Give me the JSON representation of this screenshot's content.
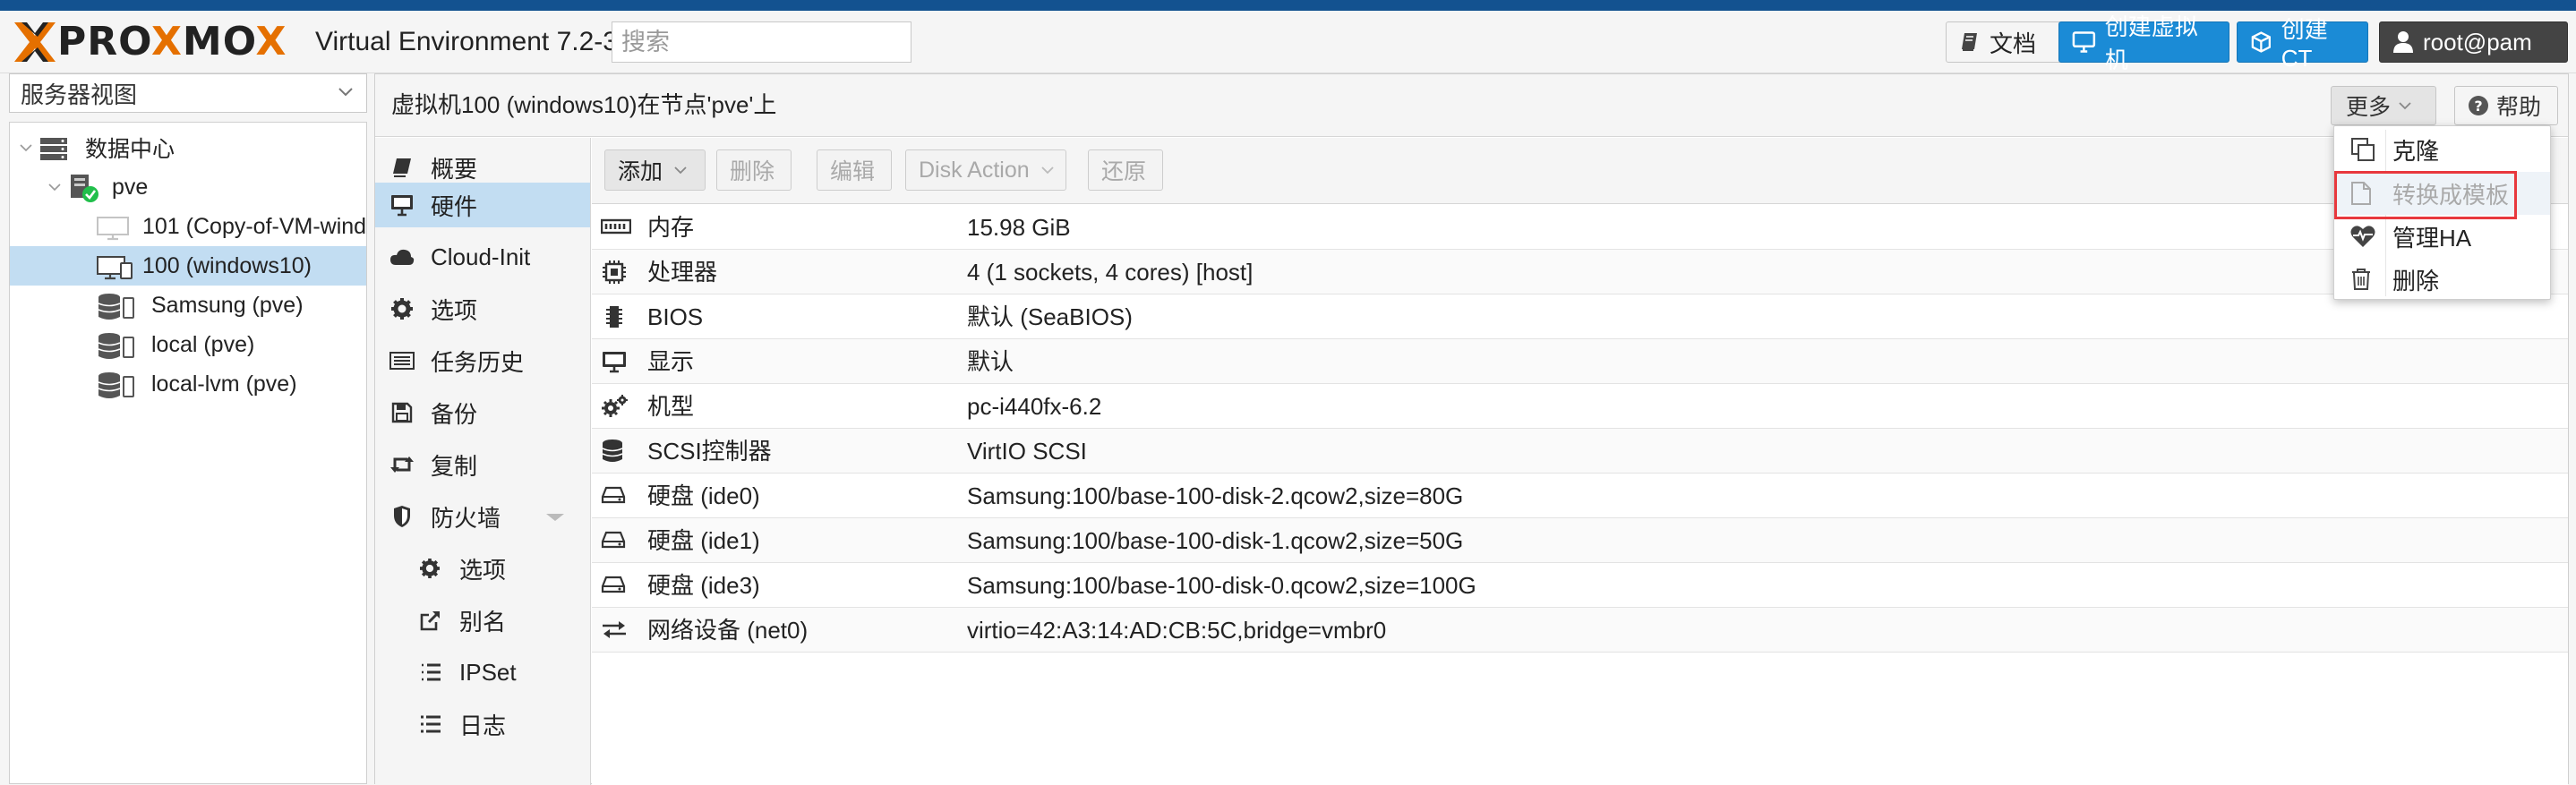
{
  "header": {
    "logo_text_1": "PRO",
    "logo_text_2": "X",
    "logo_text_3": "MO",
    "logo_text_4": "X",
    "version": "Virtual Environment 7.2-3",
    "search_placeholder": "搜索",
    "docs_label": "文档",
    "create_vm_label": "创建虚拟机",
    "create_ct_label": "创建CT",
    "user_label": "root@pam"
  },
  "sidebar": {
    "view_label": "服务器视图",
    "tree": [
      {
        "label": "数据中心",
        "icon": "datacenter-icon"
      },
      {
        "label": "pve",
        "icon": "node-icon"
      },
      {
        "label": "101 (Copy-of-VM-wind",
        "icon": "vm-template-icon"
      },
      {
        "label": "100 (windows10)",
        "icon": "vm-icon"
      },
      {
        "label": "Samsung (pve)",
        "icon": "storage-icon"
      },
      {
        "label": "local (pve)",
        "icon": "storage-icon"
      },
      {
        "label": "local-lvm (pve)",
        "icon": "storage-icon"
      }
    ]
  },
  "main": {
    "title": "虚拟机100 (windows10)在节点'pve'上",
    "more_label": "更多",
    "help_label": "帮助"
  },
  "nav": {
    "items": [
      {
        "label": "概要"
      },
      {
        "label": "硬件"
      },
      {
        "label": "Cloud-Init"
      },
      {
        "label": "选项"
      },
      {
        "label": "任务历史"
      },
      {
        "label": "备份"
      },
      {
        "label": "复制"
      },
      {
        "label": "防火墙"
      },
      {
        "label": "选项"
      },
      {
        "label": "别名"
      },
      {
        "label": "IPSet"
      },
      {
        "label": "日志"
      }
    ]
  },
  "toolbar": {
    "add_label": "添加",
    "remove_label": "删除",
    "edit_label": "编辑",
    "disk_action_label": "Disk Action",
    "revert_label": "还原"
  },
  "hardware": [
    {
      "key": "内存",
      "value": "15.98 GiB",
      "icon": "memory-icon"
    },
    {
      "key": "处理器",
      "value": "4 (1 sockets, 4 cores) [host]",
      "icon": "cpu-icon"
    },
    {
      "key": "BIOS",
      "value": "默认 (SeaBIOS)",
      "icon": "bios-icon"
    },
    {
      "key": "显示",
      "value": "默认",
      "icon": "display-icon"
    },
    {
      "key": "机型",
      "value": "pc-i440fx-6.2",
      "icon": "machine-icon"
    },
    {
      "key": "SCSI控制器",
      "value": "VirtIO SCSI",
      "icon": "database-icon"
    },
    {
      "key": "硬盘 (ide0)",
      "value": "Samsung:100/base-100-disk-2.qcow2,size=80G",
      "icon": "hdd-icon"
    },
    {
      "key": "硬盘 (ide1)",
      "value": "Samsung:100/base-100-disk-1.qcow2,size=50G",
      "icon": "hdd-icon"
    },
    {
      "key": "硬盘 (ide3)",
      "value": "Samsung:100/base-100-disk-0.qcow2,size=100G",
      "icon": "hdd-icon"
    },
    {
      "key": "网络设备 (net0)",
      "value": "virtio=42:A3:14:AD:CB:5C,bridge=vmbr0",
      "icon": "network-icon"
    }
  ],
  "more_menu": {
    "items": [
      {
        "label": "克隆",
        "icon": "clone-icon"
      },
      {
        "label": "转换成模板",
        "icon": "template-icon"
      },
      {
        "label": "管理HA",
        "icon": "ha-heartbeat-icon"
      },
      {
        "label": "删除",
        "icon": "trash-icon"
      }
    ]
  },
  "colors": {
    "brand_blue": "#135290",
    "accent_orange": "#e57000",
    "button_blue": "#1b8bd6",
    "selection": "#c2ddf2",
    "highlight_red": "#e8383d"
  }
}
